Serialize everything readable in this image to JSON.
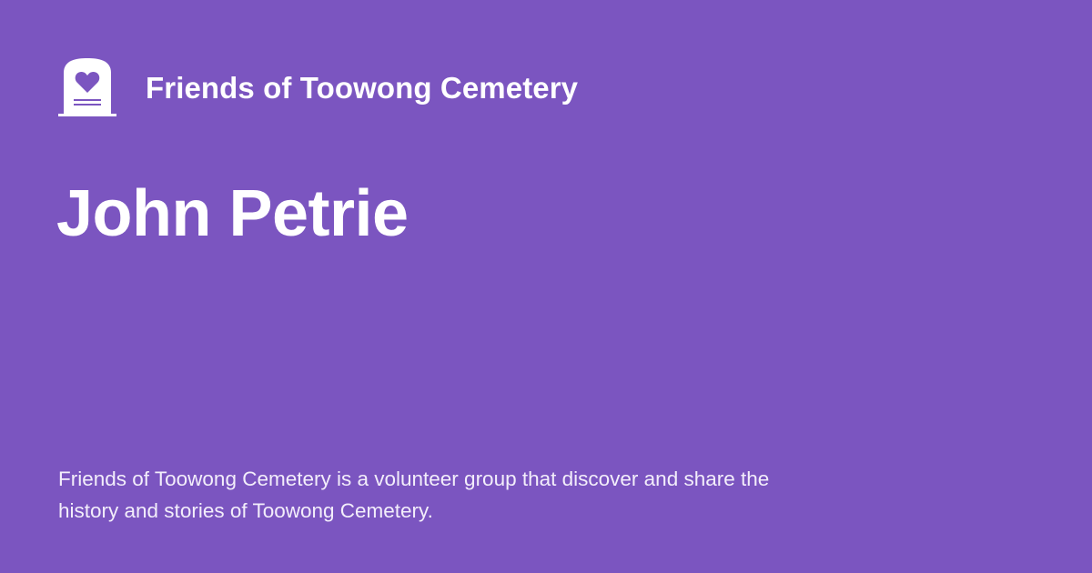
{
  "theme": {
    "background": "#7b55c0",
    "foreground": "#ffffff"
  },
  "header": {
    "logo_icon": "tombstone-heart-icon",
    "site_name": "Friends of Toowong Cemetery"
  },
  "main": {
    "title": "John Petrie"
  },
  "footer": {
    "description": "Friends of Toowong Cemetery is a volunteer group that discover and share the history and stories of Toowong Cemetery."
  }
}
